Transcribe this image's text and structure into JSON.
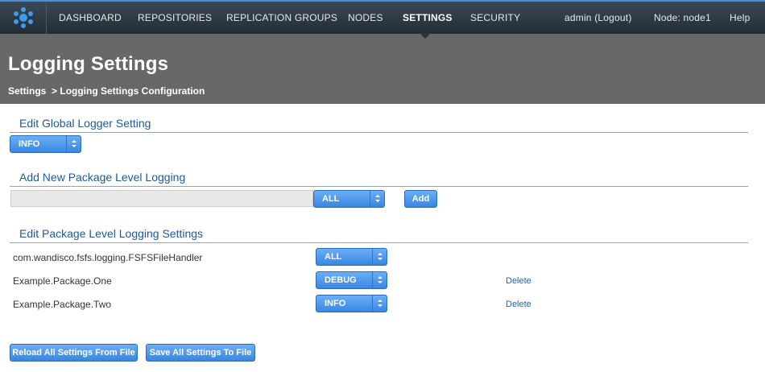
{
  "nav": {
    "items": [
      "DASHBOARD",
      "REPOSITORIES",
      "REPLICATION GROUPS",
      "NODES",
      "SETTINGS",
      "SECURITY"
    ],
    "active": "SETTINGS",
    "user": "admin (Logout)",
    "node": "Node: node1",
    "help": "Help"
  },
  "header": {
    "title": "Logging Settings",
    "breadcrumb_root": "Settings",
    "breadcrumb_current": "> Logging Settings Configuration"
  },
  "global": {
    "title": "Edit Global Logger Setting",
    "level": "INFO"
  },
  "add_new": {
    "title": "Add New Package Level Logging",
    "input_value": "",
    "level": "ALL",
    "add_label": "Add"
  },
  "packages": {
    "title": "Edit Package Level Logging Settings",
    "rows": [
      {
        "name": "com.wandisco.fsfs.logging.FSFSFileHandler",
        "level": "ALL",
        "delete": ""
      },
      {
        "name": "Example.Package.One",
        "level": "DEBUG",
        "delete": "Delete"
      },
      {
        "name": "Example.Package.Two",
        "level": "INFO",
        "delete": "Delete"
      }
    ]
  },
  "footer": {
    "reload_label": "Reload All Settings From File",
    "save_label": "Save All Settings To File"
  },
  "colors": {
    "nav_bg": "#2a343c",
    "header_bg": "#686868",
    "section_title": "#1f5a96",
    "button_blue": "#3a86e0",
    "link_blue": "#1f63b7"
  }
}
